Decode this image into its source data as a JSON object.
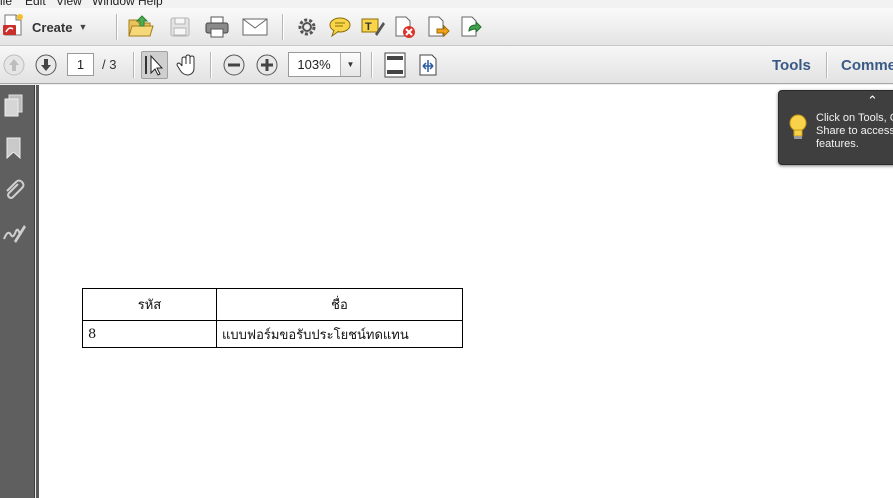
{
  "menu": {
    "items": [
      "ile",
      "Edit",
      "View",
      "Window",
      "Help"
    ]
  },
  "toolbar": {
    "create_label": "Create",
    "icons": [
      "open-folder-icon",
      "save-icon",
      "print-icon",
      "email-icon",
      "settings-icon",
      "comment-icon",
      "highlight-text-icon",
      "delete-page-icon",
      "export-icon",
      "share-icon"
    ]
  },
  "nav": {
    "current_page": "1",
    "total_pages": "/ 3",
    "zoom": "103%",
    "tools_label": "Tools",
    "comment_label": "Comme"
  },
  "document": {
    "table": {
      "headers": [
        "รหัส",
        "ชื่อ"
      ],
      "rows": [
        [
          "8",
          "แบบฟอร์มขอรับประโยชน์ทดแทน"
        ]
      ]
    }
  },
  "tooltip": {
    "line1": "Click on Tools, C",
    "line2": "Share to access",
    "line3": "features."
  }
}
